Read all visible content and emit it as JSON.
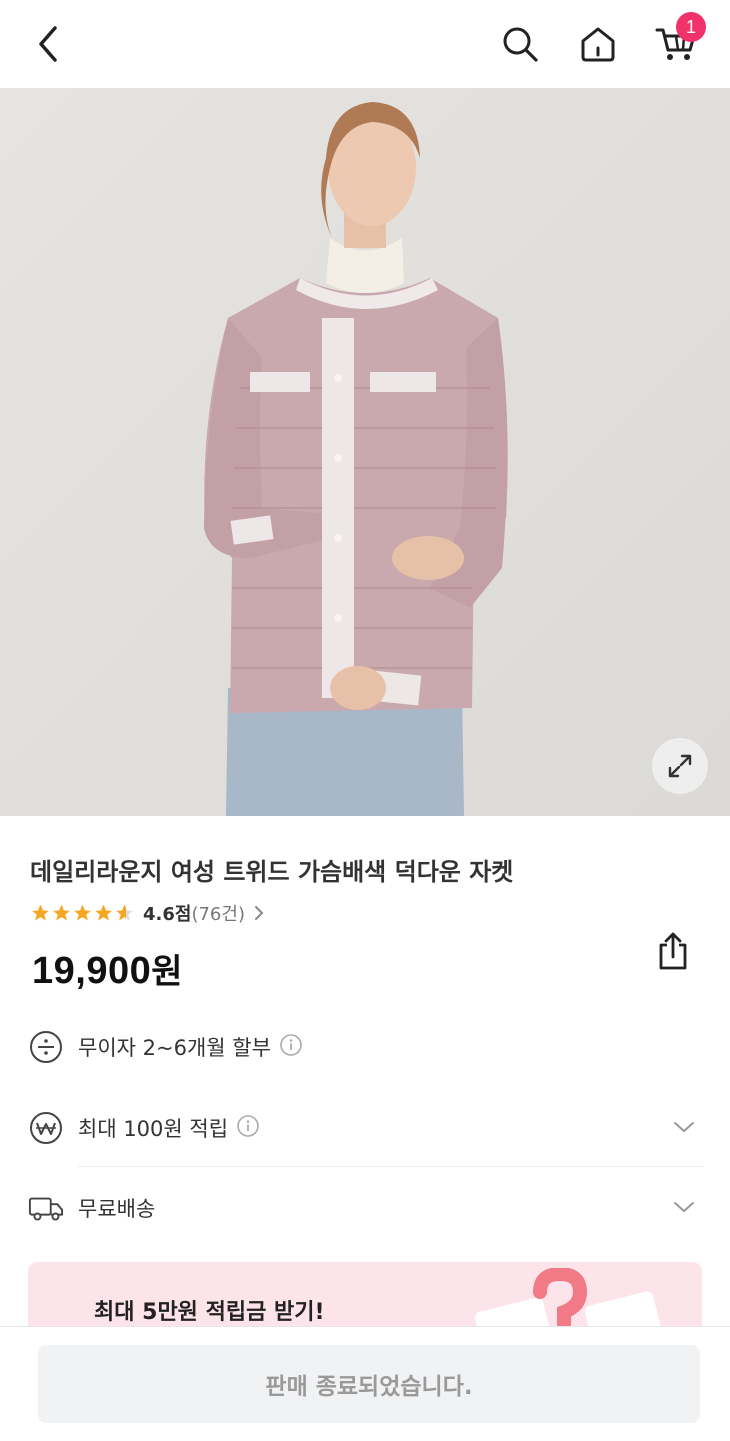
{
  "header": {
    "back_icon": "chevron-left-icon",
    "search_icon": "search-icon",
    "home_icon": "home-icon",
    "cart_icon": "cart-icon",
    "cart_badge": "1"
  },
  "product": {
    "image_alt": "pink tweed down jacket",
    "title": "데일리라운지 여성 트위드 가슴배색 덕다운 자켓",
    "rating_score": "4.6점",
    "rating_count": "(76건)",
    "rating_value": 4.6,
    "price": "19,900",
    "price_unit": "원"
  },
  "benefits": {
    "installment": "무이자 2~6개월 할부",
    "points": "최대 100원 적립",
    "shipping": "무료배송"
  },
  "banner": {
    "text": "최대 5만원 적립금 받기!"
  },
  "footer": {
    "soldout_label": "판매 종료되었습니다."
  },
  "colors": {
    "accent": "#f0336b",
    "star": "#f5a623",
    "banner_bg": "#fde3ea"
  }
}
